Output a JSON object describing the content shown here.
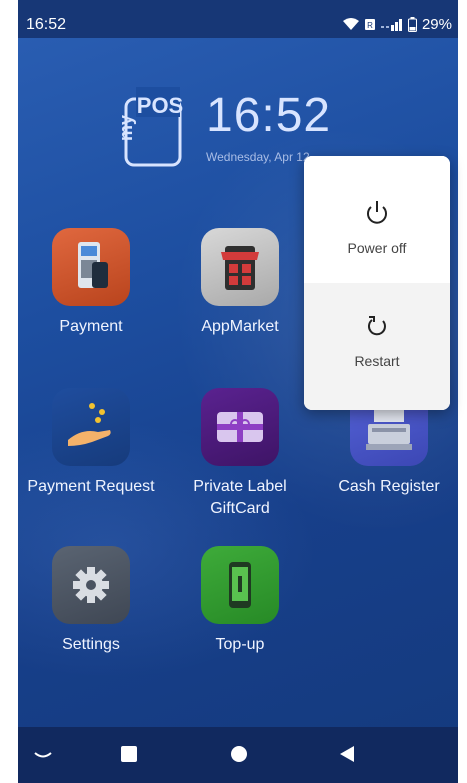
{
  "status_bar": {
    "time": "16:52",
    "battery": "29%",
    "icons": [
      "wifi-icon",
      "sim-icon",
      "signal-icon",
      "battery-icon"
    ]
  },
  "brand": {
    "logo_text_top": "POS",
    "logo_text_side": "my"
  },
  "clock": {
    "time": "16:52",
    "date": "Wednesday, Apr 12"
  },
  "apps": [
    {
      "label": "Payment",
      "icon": "payment-terminal-icon"
    },
    {
      "label": "AppMarket",
      "icon": "storefront-icon"
    },
    {
      "label": "Payment Request",
      "icon": "coins-hand-icon"
    },
    {
      "label": "Private Label GiftCard",
      "icon": "gift-card-icon"
    },
    {
      "label": "Cash Register",
      "icon": "cash-register-icon"
    },
    {
      "label": "Settings",
      "icon": "gear-icon"
    },
    {
      "label": "Top-up",
      "icon": "phone-topup-icon"
    }
  ],
  "power_menu": {
    "power_off": "Power off",
    "restart": "Restart"
  },
  "nav_bar": [
    "collapse-icon",
    "recents-icon",
    "home-icon",
    "back-icon"
  ],
  "colors": {
    "accent_status": "#173776",
    "nav": "#11295f",
    "wallpaper": "#1d4ea0"
  }
}
